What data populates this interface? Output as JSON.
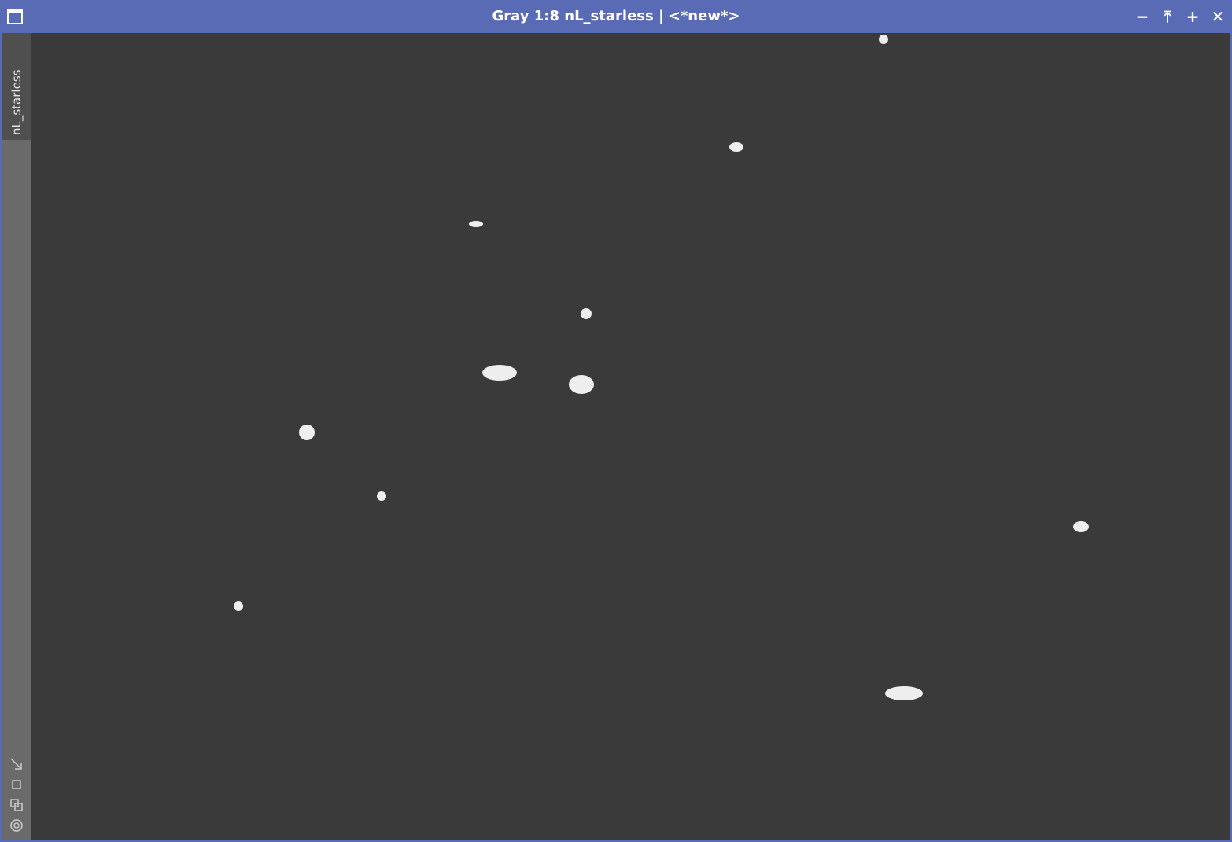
{
  "window": {
    "title": "Gray 1:8 nL_starless | <*new*>",
    "view_tab": "nL_starless",
    "buttons": {
      "minimize": "−",
      "shade": "⤒",
      "maximize": "+",
      "close": "✕"
    },
    "icons": [
      "window-icon",
      "minimize-icon",
      "shade-icon",
      "maximize-icon",
      "close-icon",
      "fit-view-icon",
      "zoom-box-icon",
      "clone-view-icon",
      "identity-icon"
    ],
    "colors": {
      "titlebar": "#5a6bb5",
      "sidebar": "#6a6a6a",
      "image_background": "#3a3a3a"
    }
  }
}
